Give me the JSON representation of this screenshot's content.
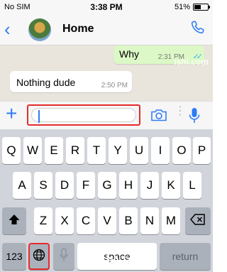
{
  "status": {
    "carrier": "No SIM",
    "time": "3:38 PM",
    "battery": "51%",
    "battery_level": 0.51
  },
  "nav": {
    "title": "Home"
  },
  "messages": {
    "outgoing": {
      "text": "Why",
      "time": "2:31 PM",
      "ticks": "✓✓"
    },
    "incoming": {
      "text": "Nothing dude",
      "time": "2:50 PM"
    },
    "watermark": "ishi.com"
  },
  "input": {
    "value": ""
  },
  "keyboard": {
    "row1": [
      "Q",
      "W",
      "E",
      "R",
      "T",
      "Y",
      "U",
      "I",
      "O",
      "P"
    ],
    "row2": [
      "A",
      "S",
      "D",
      "F",
      "G",
      "H",
      "J",
      "K",
      "L"
    ],
    "row3": [
      "Z",
      "X",
      "C",
      "V",
      "B",
      "N",
      "M"
    ],
    "numbers_key": "123",
    "space_key": "space",
    "return_key": "return",
    "space_watermark": "ishi.com"
  },
  "colors": {
    "accent": "#2e7cf6",
    "highlight": "#e62b2b",
    "outgoing_bubble": "#dcf8c6"
  },
  "icons": [
    "back-chevron-icon",
    "call-icon",
    "add-icon",
    "camera-icon",
    "microphone-icon",
    "shift-icon",
    "delete-icon",
    "globe-icon",
    "dictation-mic-icon"
  ]
}
